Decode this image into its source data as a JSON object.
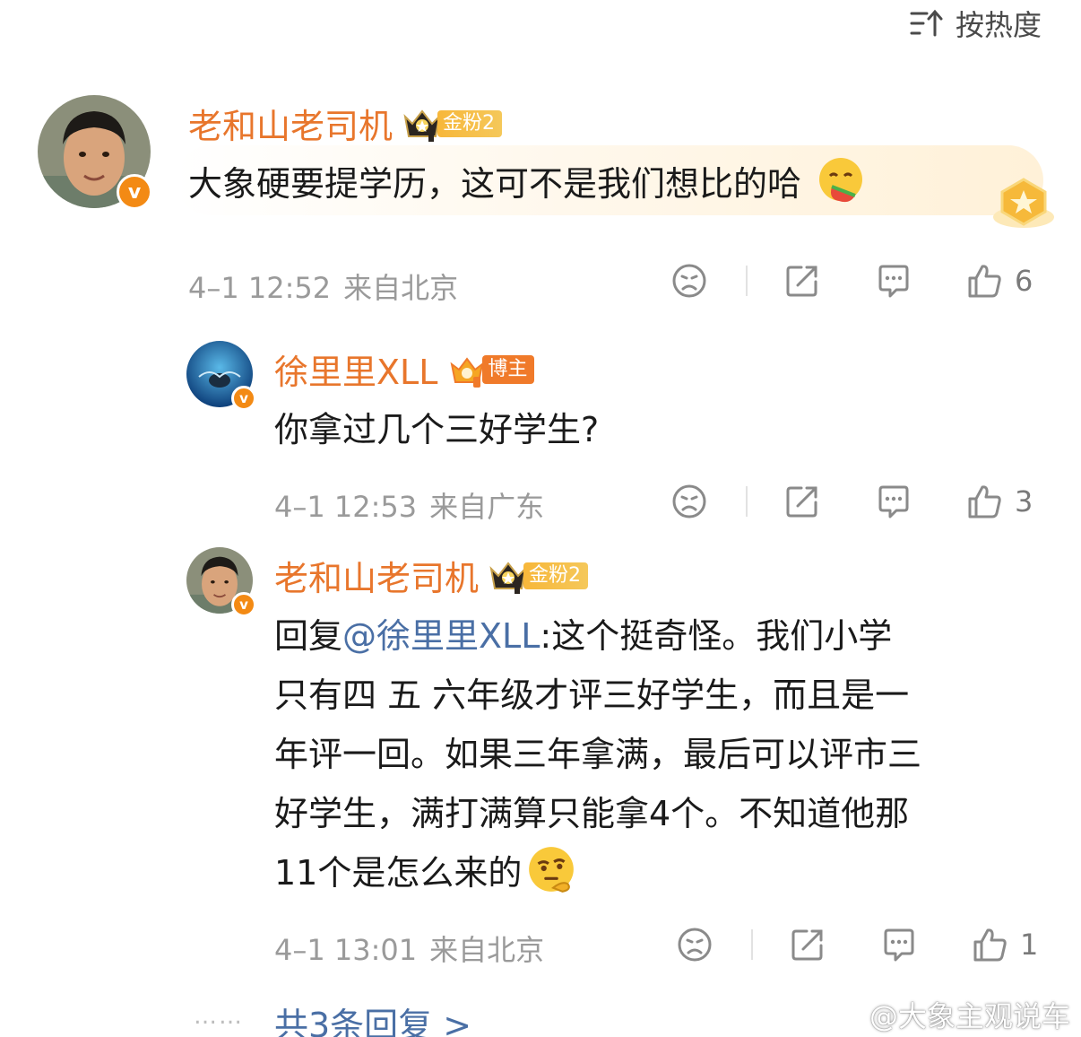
{
  "sort": {
    "label": "按热度"
  },
  "comments": [
    {
      "username": "老和山老司机",
      "badge": "金粉2",
      "text": "大象硬要提学历，这可不是我们想比的哈",
      "time": "4–1 12:52",
      "location": "来自北京",
      "likes": "6"
    },
    {
      "username": "徐里里XLL",
      "badge": "博主",
      "text": "你拿过几个三好学生?",
      "time": "4–1 12:53",
      "location": "来自广东",
      "likes": "3"
    },
    {
      "username": "老和山老司机",
      "badge": "金粉2",
      "reply_prefix": "回复",
      "mention": "@徐里里XLL",
      "text_lines": [
        ":这个挺奇怪。我们小学",
        "只有四 五 六年级才评三好学生，而且是一",
        "年评一回。如果三年拿满，最后可以评市三",
        "好学生，满打满算只能拿4个。不知道他那",
        "11个是怎么来的"
      ],
      "time": "4–1 13:01",
      "location": "来自北京",
      "likes": "1"
    }
  ],
  "more_replies": "共3条回复 >",
  "watermark": "@大象主观说车",
  "colors": {
    "username": "#e8762c",
    "mention": "#4a6fa5",
    "meta": "#9a9a9a",
    "verified": "#f38a14"
  }
}
